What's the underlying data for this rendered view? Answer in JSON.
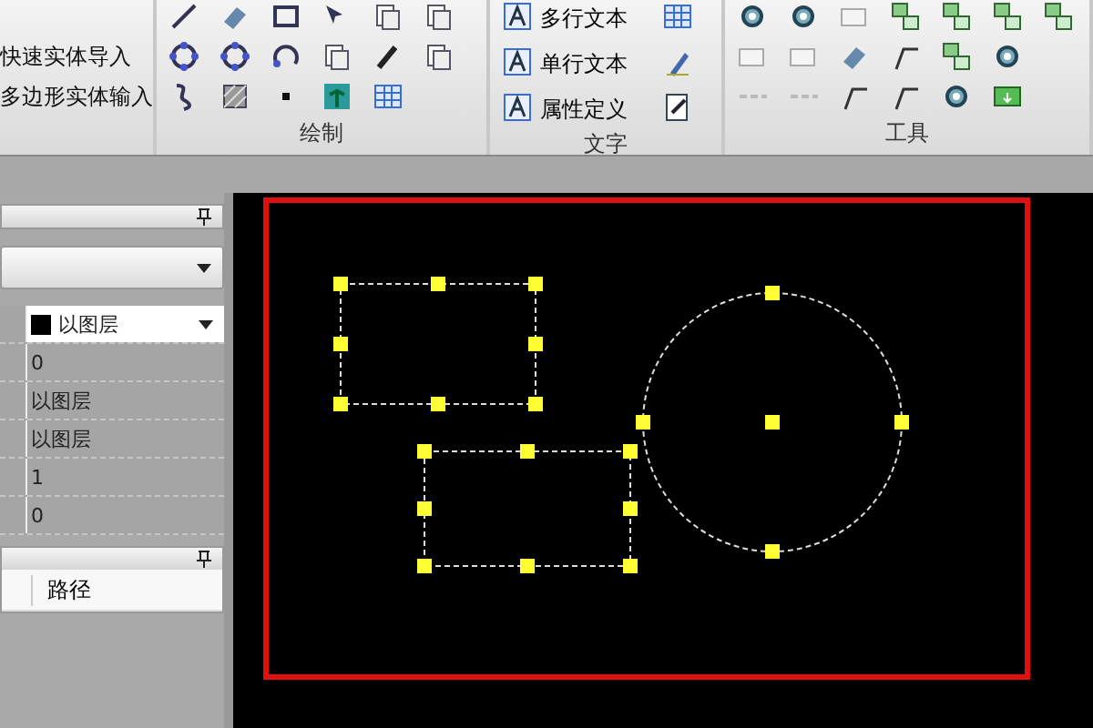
{
  "ribbon": {
    "left_commands": [
      "快速实体导入",
      "多边形实体输入"
    ],
    "groups": [
      {
        "kind": "draw",
        "title": "绘制"
      },
      {
        "kind": "text",
        "title": "文字",
        "commands": [
          "多行文本",
          "单行文本",
          "属性定义"
        ]
      },
      {
        "kind": "tools",
        "title": "工具"
      }
    ]
  },
  "properties_panel": {
    "rows": [
      {
        "kind": "color",
        "value": "以图层",
        "selected": true
      },
      {
        "kind": "text",
        "value": "0",
        "selected": false
      },
      {
        "kind": "text",
        "value": "以图层",
        "selected": false
      },
      {
        "kind": "text",
        "value": "以图层",
        "selected": false
      },
      {
        "kind": "text",
        "value": "1",
        "selected": false
      },
      {
        "kind": "text",
        "value": "0",
        "selected": false
      }
    ]
  },
  "file_panel": {
    "columns": [
      "路径"
    ]
  },
  "drawing": {
    "entities": [
      {
        "kind": "rectangle",
        "selected": true
      },
      {
        "kind": "rectangle",
        "selected": true
      },
      {
        "kind": "circle",
        "selected": true
      }
    ]
  }
}
